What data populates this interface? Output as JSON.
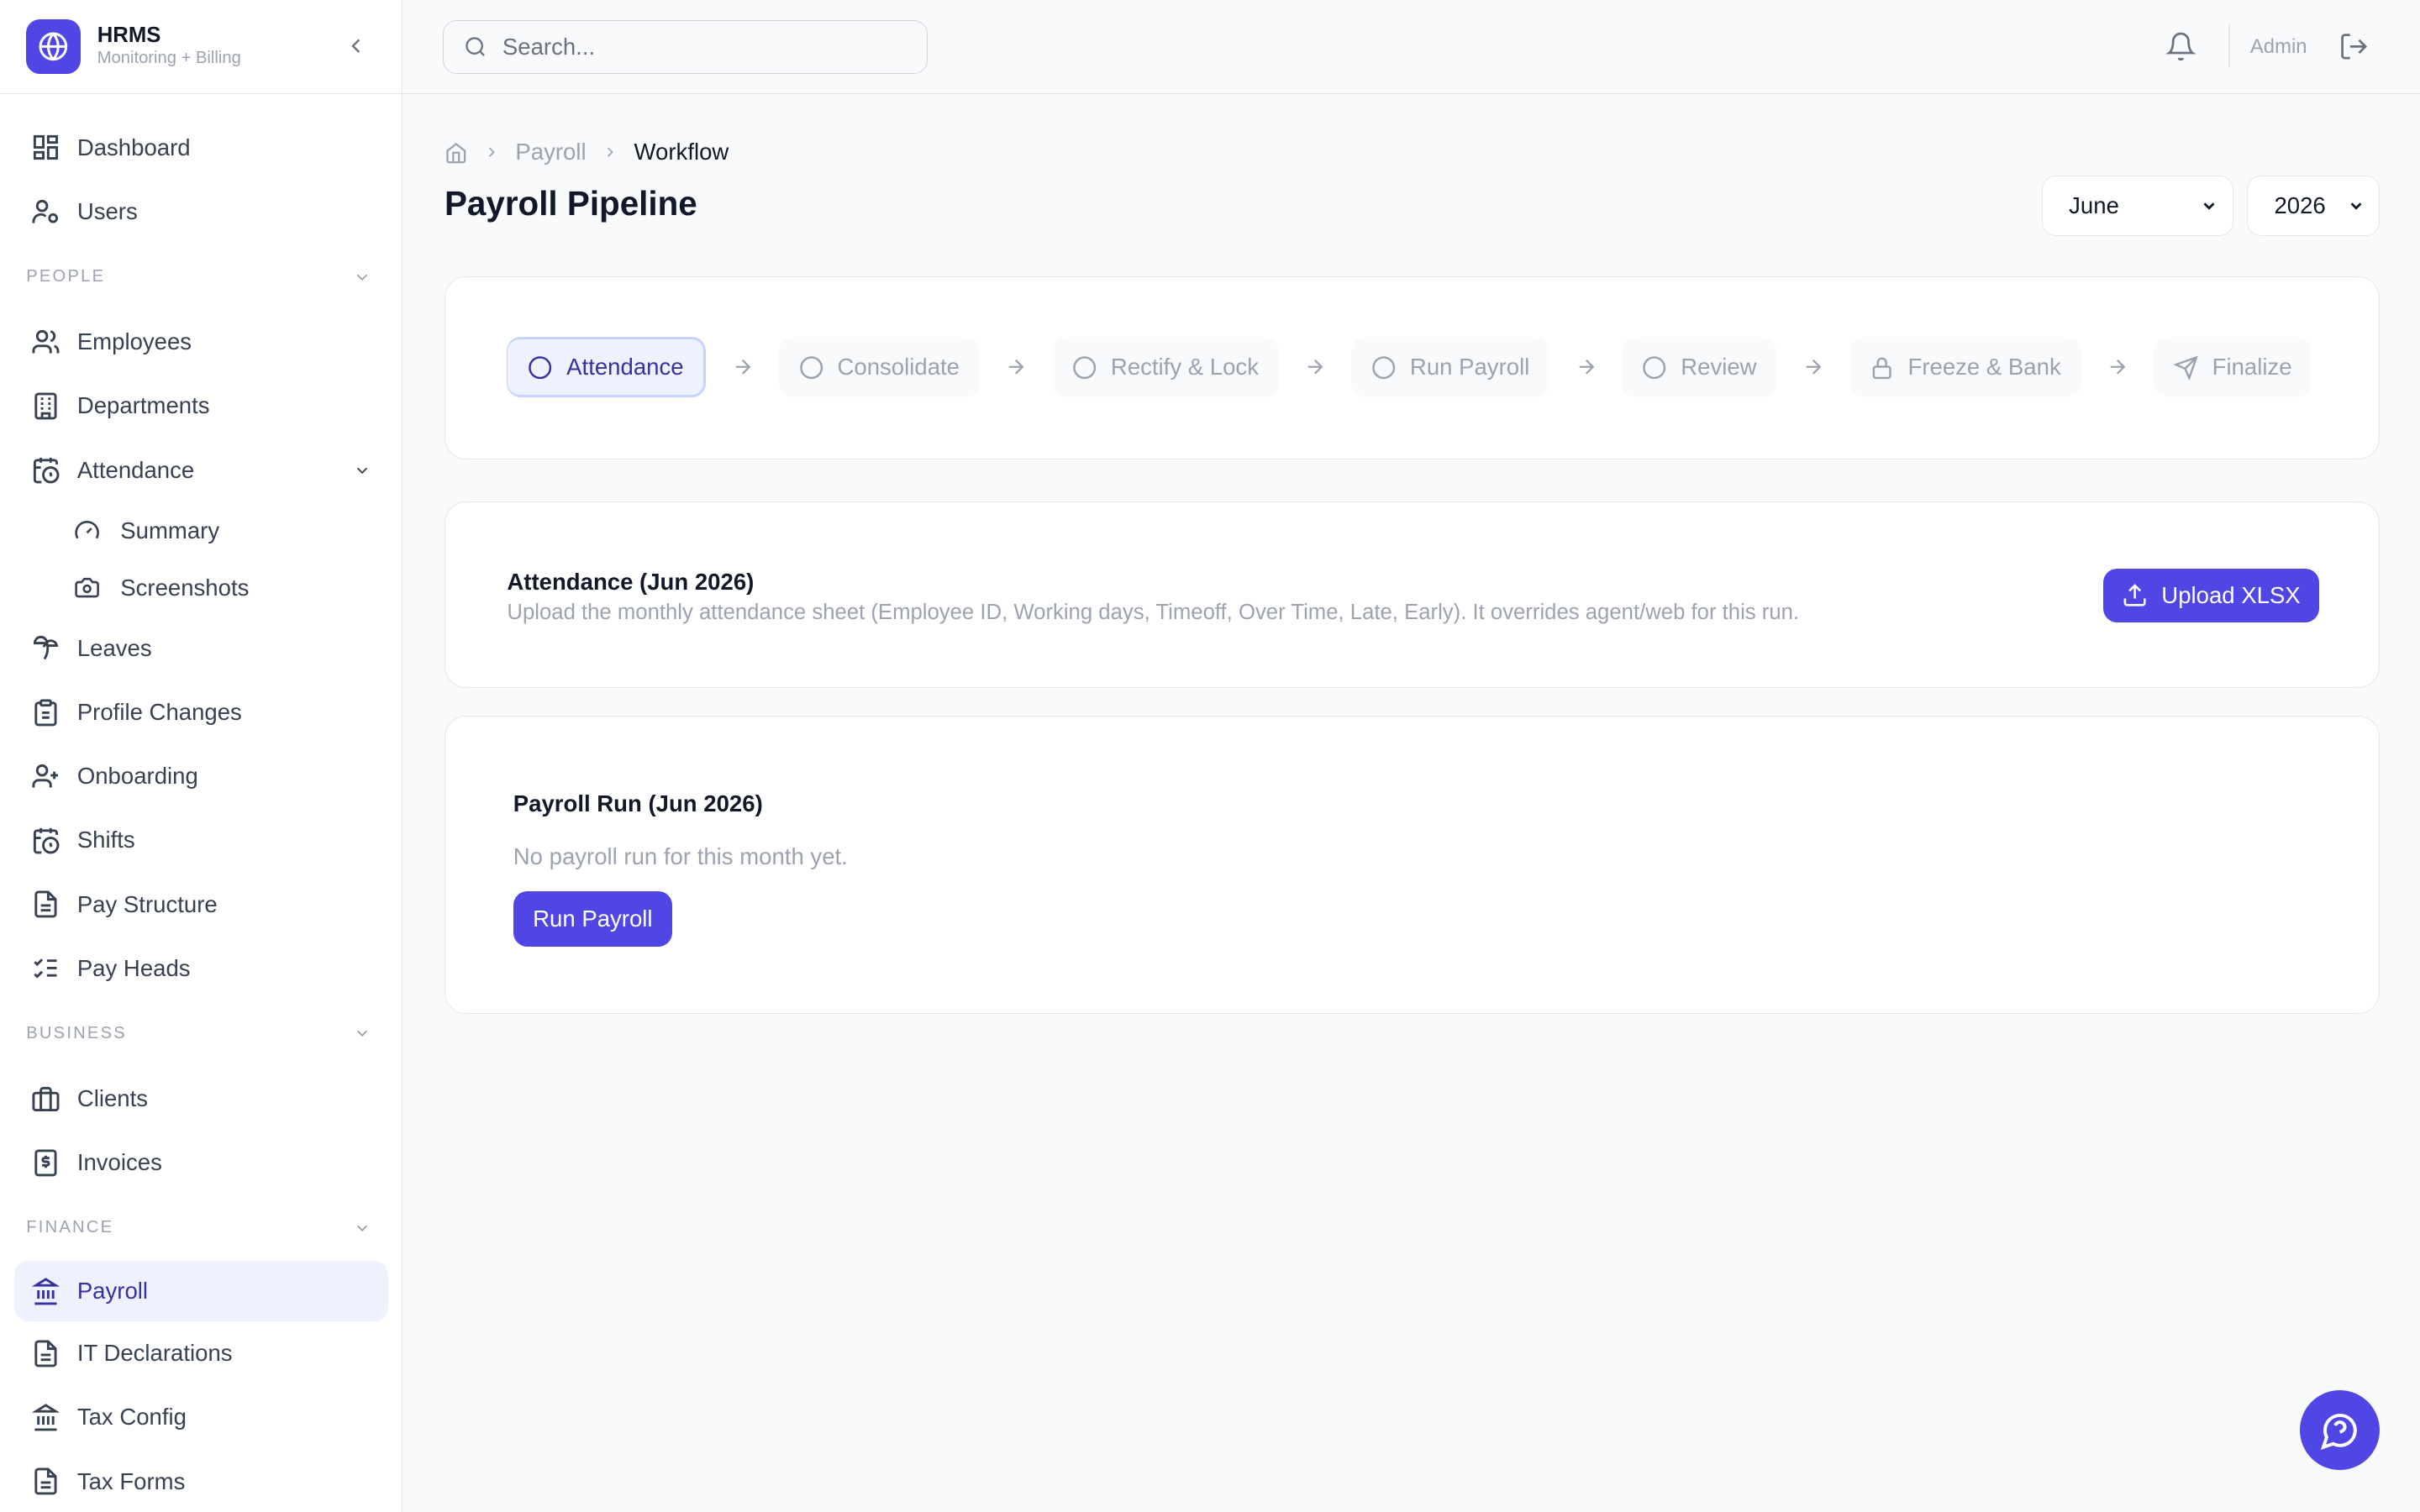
{
  "brand": {
    "title": "HRMS",
    "subtitle": "Monitoring + Billing"
  },
  "sidebar": {
    "items_top": [
      {
        "label": "Dashboard",
        "icon": "dashboard-icon"
      },
      {
        "label": "Users",
        "icon": "user-cog-icon"
      }
    ],
    "section_people": "PEOPLE",
    "people": [
      {
        "label": "Employees",
        "icon": "users-icon"
      },
      {
        "label": "Departments",
        "icon": "building-icon"
      },
      {
        "label": "Attendance",
        "icon": "calendar-clock-icon",
        "expanded": true
      }
    ],
    "attendance_sub": [
      {
        "label": "Summary",
        "icon": "gauge-icon"
      },
      {
        "label": "Screenshots",
        "icon": "camera-icon"
      }
    ],
    "people_more": [
      {
        "label": "Leaves",
        "icon": "palm-tree-icon"
      },
      {
        "label": "Profile Changes",
        "icon": "clipboard-icon"
      },
      {
        "label": "Onboarding",
        "icon": "user-plus-icon"
      },
      {
        "label": "Shifts",
        "icon": "calendar-clock-icon"
      },
      {
        "label": "Pay Structure",
        "icon": "file-text-icon"
      },
      {
        "label": "Pay Heads",
        "icon": "list-checks-icon"
      }
    ],
    "section_business": "BUSINESS",
    "business": [
      {
        "label": "Clients",
        "icon": "briefcase-icon"
      },
      {
        "label": "Invoices",
        "icon": "receipt-dollar-icon"
      }
    ],
    "section_finance": "FINANCE",
    "finance": [
      {
        "label": "Payroll",
        "icon": "bank-icon",
        "active": true
      },
      {
        "label": "IT Declarations",
        "icon": "file-text-icon"
      },
      {
        "label": "Tax Config",
        "icon": "bank-icon"
      },
      {
        "label": "Tax Forms",
        "icon": "file-text-icon"
      }
    ]
  },
  "topbar": {
    "search_placeholder": "Search...",
    "user": "Admin"
  },
  "breadcrumb": [
    "Payroll",
    "Workflow"
  ],
  "page": {
    "title": "Payroll Pipeline",
    "month": "June",
    "year": "2026"
  },
  "steps": [
    {
      "label": "Attendance",
      "current": true
    },
    {
      "label": "Consolidate"
    },
    {
      "label": "Rectify & Lock"
    },
    {
      "label": "Run Payroll"
    },
    {
      "label": "Review"
    },
    {
      "label": "Freeze & Bank",
      "icon": "lock-icon"
    },
    {
      "label": "Finalize",
      "icon": "send-icon"
    }
  ],
  "attendance_card": {
    "title": "Attendance (Jun 2026)",
    "description": "Upload the monthly attendance sheet (Employee ID, Working days, Timeoff, Over Time, Late, Early). It overrides agent/web for this run.",
    "button": "Upload XLSX"
  },
  "payroll_card": {
    "title": "Payroll Run (Jun 2026)",
    "empty": "No payroll run for this month yet.",
    "button": "Run Payroll"
  },
  "colors": {
    "accent": "#4f46e5",
    "active_bg": "#eef2ff",
    "active_text": "#3730a3",
    "muted": "#9ca3af"
  }
}
